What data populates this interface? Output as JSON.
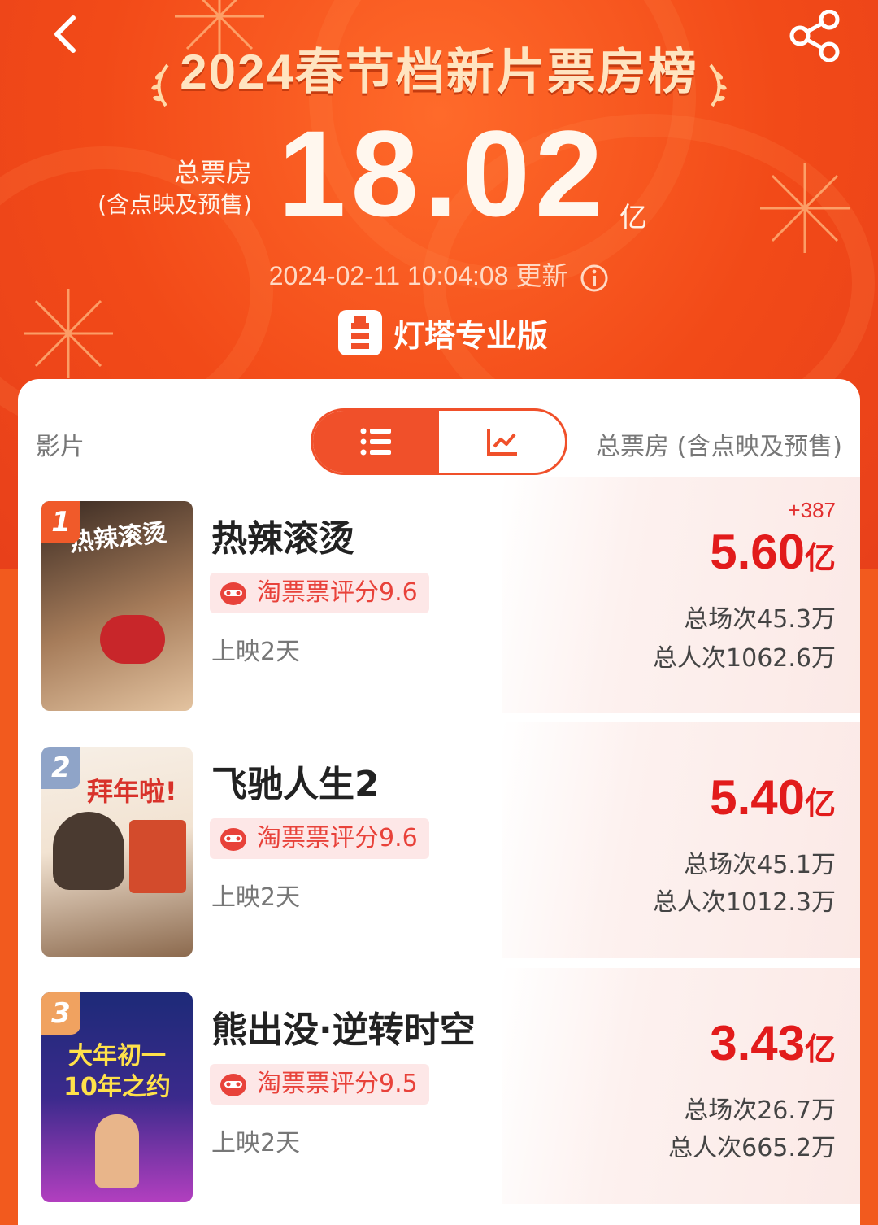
{
  "header": {
    "title": "2024春节档新片票房榜",
    "total_label_1": "总票房",
    "total_label_2": "(含点映及预售)",
    "total_value": "18.02",
    "total_unit": "亿",
    "update_time": "2024-02-11 10:04:08 更新",
    "brand_name": "灯塔专业版"
  },
  "table_header": {
    "film_col": "影片",
    "total_col": "总票房 (含点映及预售)"
  },
  "films": [
    {
      "rank": "1",
      "name": "热辣滚烫",
      "rating": "淘票票评分9.6",
      "days": "上映2天",
      "delta": "+387",
      "box_value": "5.60",
      "box_unit": "亿",
      "shows": "总场次45.3万",
      "viewers": "总人次1062.6万",
      "poster_text": "热辣滚烫",
      "poster_colors": [
        "#3a2a22",
        "#c8a27c"
      ],
      "badge_color": "#f05a2a"
    },
    {
      "rank": "2",
      "name": "飞驰人生2",
      "rating": "淘票票评分9.6",
      "days": "上映2天",
      "delta": "",
      "box_value": "5.40",
      "box_unit": "亿",
      "shows": "总场次45.1万",
      "viewers": "总人次1012.3万",
      "poster_text": "拜年啦!",
      "poster_colors": [
        "#f7efe6",
        "#d34b2c"
      ],
      "badge_color": "#8fa4c8"
    },
    {
      "rank": "3",
      "name": "熊出没·逆转时空",
      "rating": "淘票票评分9.5",
      "days": "上映2天",
      "delta": "",
      "box_value": "3.43",
      "box_unit": "亿",
      "shows": "总场次26.7万",
      "viewers": "总人次665.2万",
      "poster_text": "大年初一 10年之约",
      "poster_colors": [
        "#1d2a78",
        "#b23fbf"
      ],
      "badge_color": "#f0a260"
    }
  ],
  "icons": {
    "back": "chevron-left-icon",
    "share": "share-icon",
    "info": "info-icon",
    "list": "list-icon",
    "chart": "trend-chart-icon",
    "rating": "taopiaopiao-icon"
  },
  "colors": {
    "accent": "#f0502a",
    "box_red": "#e21b1b"
  }
}
